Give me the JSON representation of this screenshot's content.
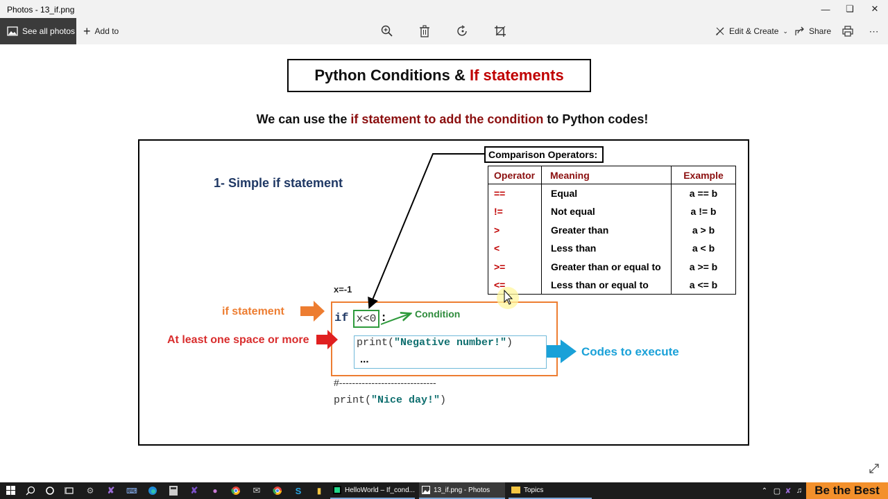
{
  "window": {
    "title": "Photos - 13_if.png",
    "minimize_icon": "minimize-icon",
    "maximize_icon": "restore-icon",
    "close_icon": "close-icon"
  },
  "toolbar": {
    "see_all_label": "See all photos",
    "add_to_label": "Add to",
    "edit_create_label": "Edit & Create",
    "share_label": "Share",
    "icons": [
      "zoom-in-icon",
      "delete-icon",
      "rotate-icon",
      "crop-icon",
      "print-icon",
      "more-icon"
    ]
  },
  "slide": {
    "title_part1": "Python Conditions & ",
    "title_part2": "If statements",
    "subtitle_part1": "We can use the ",
    "subtitle_part2": "if statement to add the condition",
    "subtitle_part3": " to Python codes!",
    "section_heading": "1- Simple if statement",
    "comparison_label": "Comparison Operators:",
    "table": {
      "headers": [
        "Operator",
        "Meaning",
        "Example"
      ],
      "rows": [
        {
          "operator": "==",
          "meaning": "Equal",
          "example": "a == b"
        },
        {
          "operator": "!=",
          "meaning": "Not equal",
          "example": "a != b"
        },
        {
          "operator": ">",
          "meaning": "Greater than",
          "example": "a > b"
        },
        {
          "operator": "<",
          "meaning": "Less than",
          "example": "a < b"
        },
        {
          "operator": ">=",
          "meaning": "Greater than or equal to",
          "example": "a >= b"
        },
        {
          "operator": "<=",
          "meaning": "Less than or equal to",
          "example": "a <= b"
        }
      ]
    },
    "x_decl": "x=-1",
    "if_label": "if statement",
    "space_label": "At least one space or more",
    "if_keyword": "if",
    "condition_code": "x<0",
    "colon": ":",
    "condition_label": "Condition",
    "print1_func": "print(",
    "print1_str": "\"Negative number!\"",
    "print1_close": ")",
    "ellipsis": "...",
    "codes_label": "Codes to execute",
    "hash_line": "#------------------------------",
    "print2_func": "print(",
    "print2_str": "\"Nice day!\"",
    "print2_close": ")",
    "colors": {
      "orange": "#ed7d31",
      "red": "#d92d2d",
      "green": "#2e9a3c",
      "blue": "#1aa1d8",
      "navy": "#1f3864",
      "title_red": "#c00000"
    }
  },
  "taskbar": {
    "apps": [
      {
        "label": "HelloWorld – If_cond...",
        "icon": "pycharm-icon"
      },
      {
        "label": "13_if.png - Photos",
        "icon": "photos-icon"
      },
      {
        "label": "Topics",
        "icon": "folder-icon"
      }
    ],
    "brand": "Be the Best"
  }
}
